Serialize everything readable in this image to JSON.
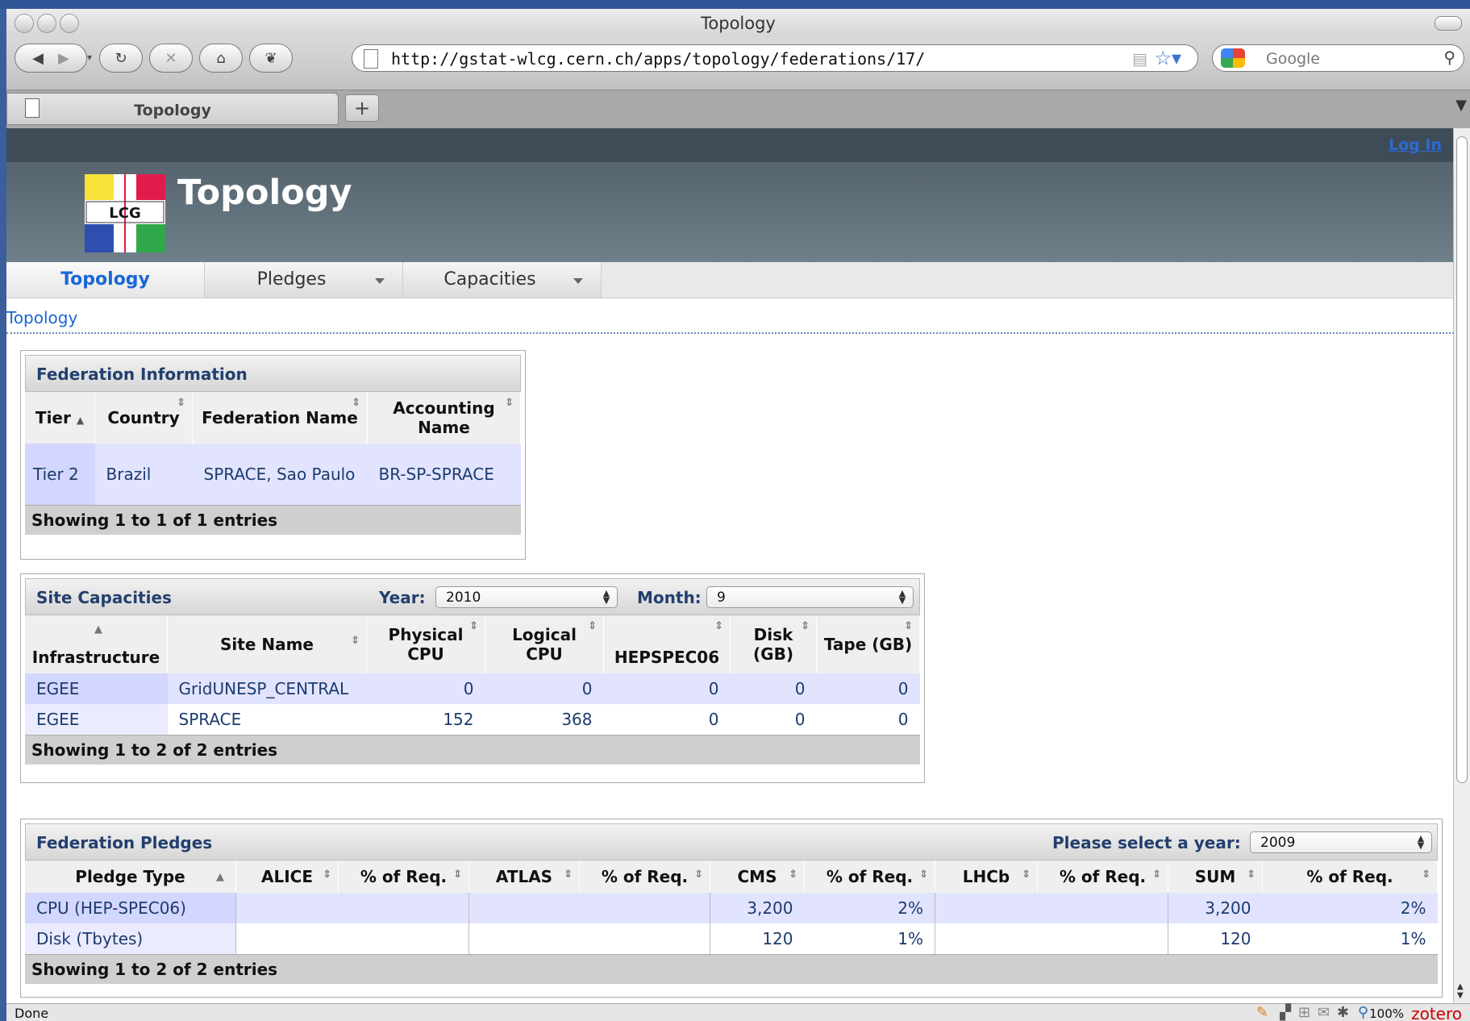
{
  "window": {
    "title": "Topology"
  },
  "browser": {
    "url": "http://gstat-wlcg.cern.ch/apps/topology/federations/17/",
    "search_placeholder": "Google",
    "tab_title": "Topology",
    "new_tab": "+"
  },
  "site": {
    "title": "Topology",
    "login": "Log In",
    "logo_text": "LCG"
  },
  "menu": {
    "items": [
      "Topology",
      "Pledges",
      "Capacities"
    ]
  },
  "breadcrumb": "Topology",
  "federation_info": {
    "title": "Federation Information",
    "headers": [
      "Tier",
      "Country",
      "Federation Name",
      "Accounting Name"
    ],
    "rows": [
      [
        "Tier 2",
        "Brazil",
        "SPRACE, Sao Paulo",
        "BR-SP-SPRACE"
      ]
    ],
    "footer": "Showing 1 to 1 of 1 entries"
  },
  "site_capacities": {
    "title": "Site Capacities",
    "year_label": "Year:",
    "year": "2010",
    "month_label": "Month:",
    "month": "9",
    "headers": [
      "Infrastructure",
      "Site Name",
      "Physical CPU",
      "Logical CPU",
      "HEPSPEC06",
      "Disk (GB)",
      "Tape (GB)"
    ],
    "rows": [
      [
        "EGEE",
        "GridUNESP_CENTRAL",
        "0",
        "0",
        "0",
        "0",
        "0"
      ],
      [
        "EGEE",
        "SPRACE",
        "152",
        "368",
        "0",
        "0",
        "0"
      ]
    ],
    "footer": "Showing 1 to 2 of 2 entries"
  },
  "federation_pledges": {
    "title": "Federation Pledges",
    "year_label": "Please select a year:",
    "year": "2009",
    "headers": [
      "Pledge Type",
      "ALICE",
      "% of Req.",
      "ATLAS",
      "% of Req.",
      "CMS",
      "% of Req.",
      "LHCb",
      "% of Req.",
      "SUM",
      "% of Req."
    ],
    "rows": [
      [
        "CPU (HEP-SPEC06)",
        "",
        "",
        "",
        "",
        "3,200",
        "2%",
        "",
        "",
        "3,200",
        "2%"
      ],
      [
        "Disk (Tbytes)",
        "",
        "",
        "",
        "",
        "120",
        "1%",
        "",
        "",
        "120",
        "1%"
      ]
    ],
    "footer": "Showing 1 to 2 of 2 entries"
  },
  "status": {
    "text": "Done",
    "zoom": "100%",
    "zotero": "zotero"
  }
}
